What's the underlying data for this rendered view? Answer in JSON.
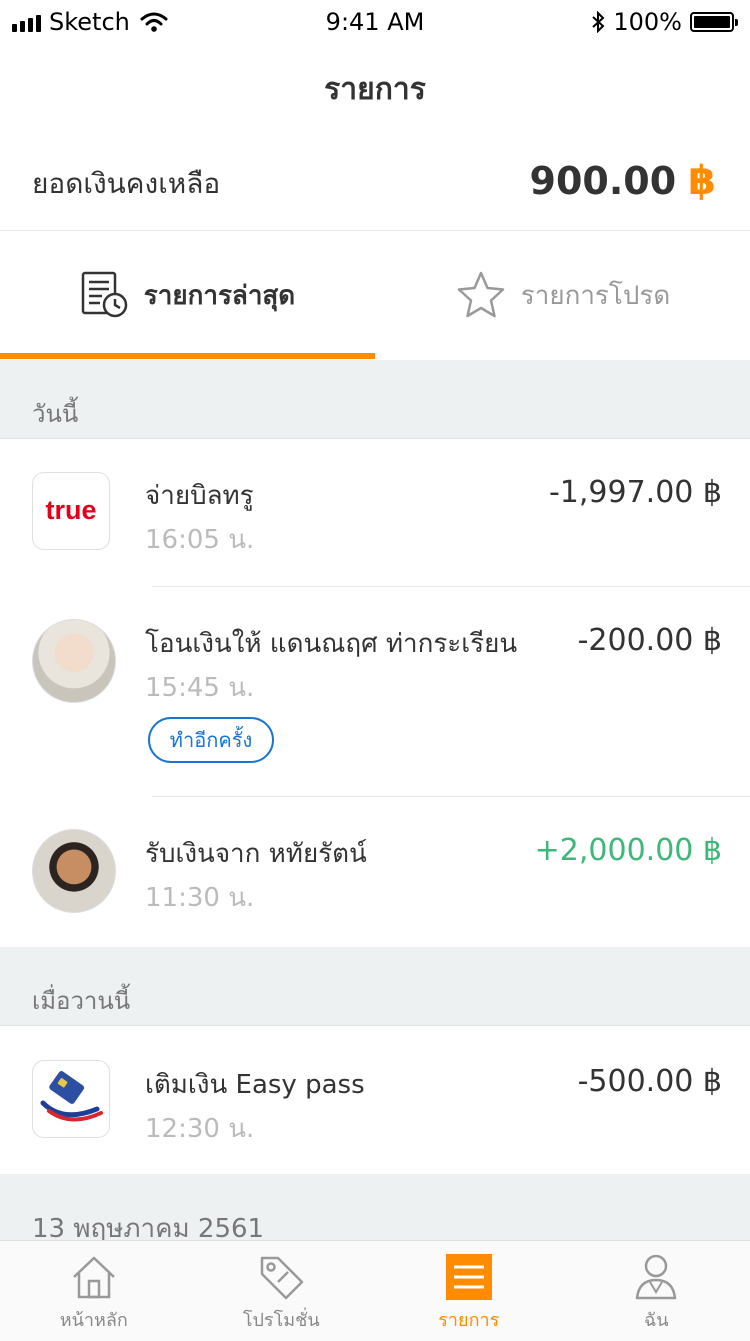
{
  "status_bar": {
    "carrier": "Sketch",
    "time": "9:41 AM",
    "battery": "100%"
  },
  "header": {
    "title": "รายการ"
  },
  "balance": {
    "label": "ยอดเงินคงเหลือ",
    "amount": "900.00",
    "currency": "฿"
  },
  "tabs": [
    {
      "label": "รายการล่าสุด",
      "active": true
    },
    {
      "label": "รายการโปรด",
      "active": false
    }
  ],
  "sections": {
    "today": "วันนี้",
    "yesterday": "เมื่อวานนี้",
    "older": "13 พฤษภาคม 2561"
  },
  "transactions": {
    "t1": {
      "logo_text": "true",
      "title": "จ่ายบิลทรู",
      "time": "16:05 น.",
      "amount": "-1,997.00 ฿"
    },
    "t2": {
      "title": "โอนเงินให้ แดนณฤศ ท่ากระเรียน",
      "time": "15:45 น.",
      "amount": "-200.00 ฿",
      "action": "ทำอีกครั้ง"
    },
    "t3": {
      "title": "รับเงินจาก หทัยรัตน์",
      "time": "11:30 น.",
      "amount": "+2,000.00 ฿"
    },
    "t4": {
      "title": "เติมเงิน Easy pass",
      "time": "12:30 น.",
      "amount": "-500.00 ฿"
    }
  },
  "bottom_nav": [
    {
      "label": "หน้าหลัก",
      "icon": "home-icon"
    },
    {
      "label": "โปรโมชั่น",
      "icon": "tag-icon"
    },
    {
      "label": "รายการ",
      "icon": "list-icon",
      "active": true
    },
    {
      "label": "ฉัน",
      "icon": "profile-icon"
    }
  ],
  "colors": {
    "accent": "#ff8c00",
    "positive": "#3cb878",
    "link": "#1976d2",
    "true_brand": "#e4001b"
  }
}
